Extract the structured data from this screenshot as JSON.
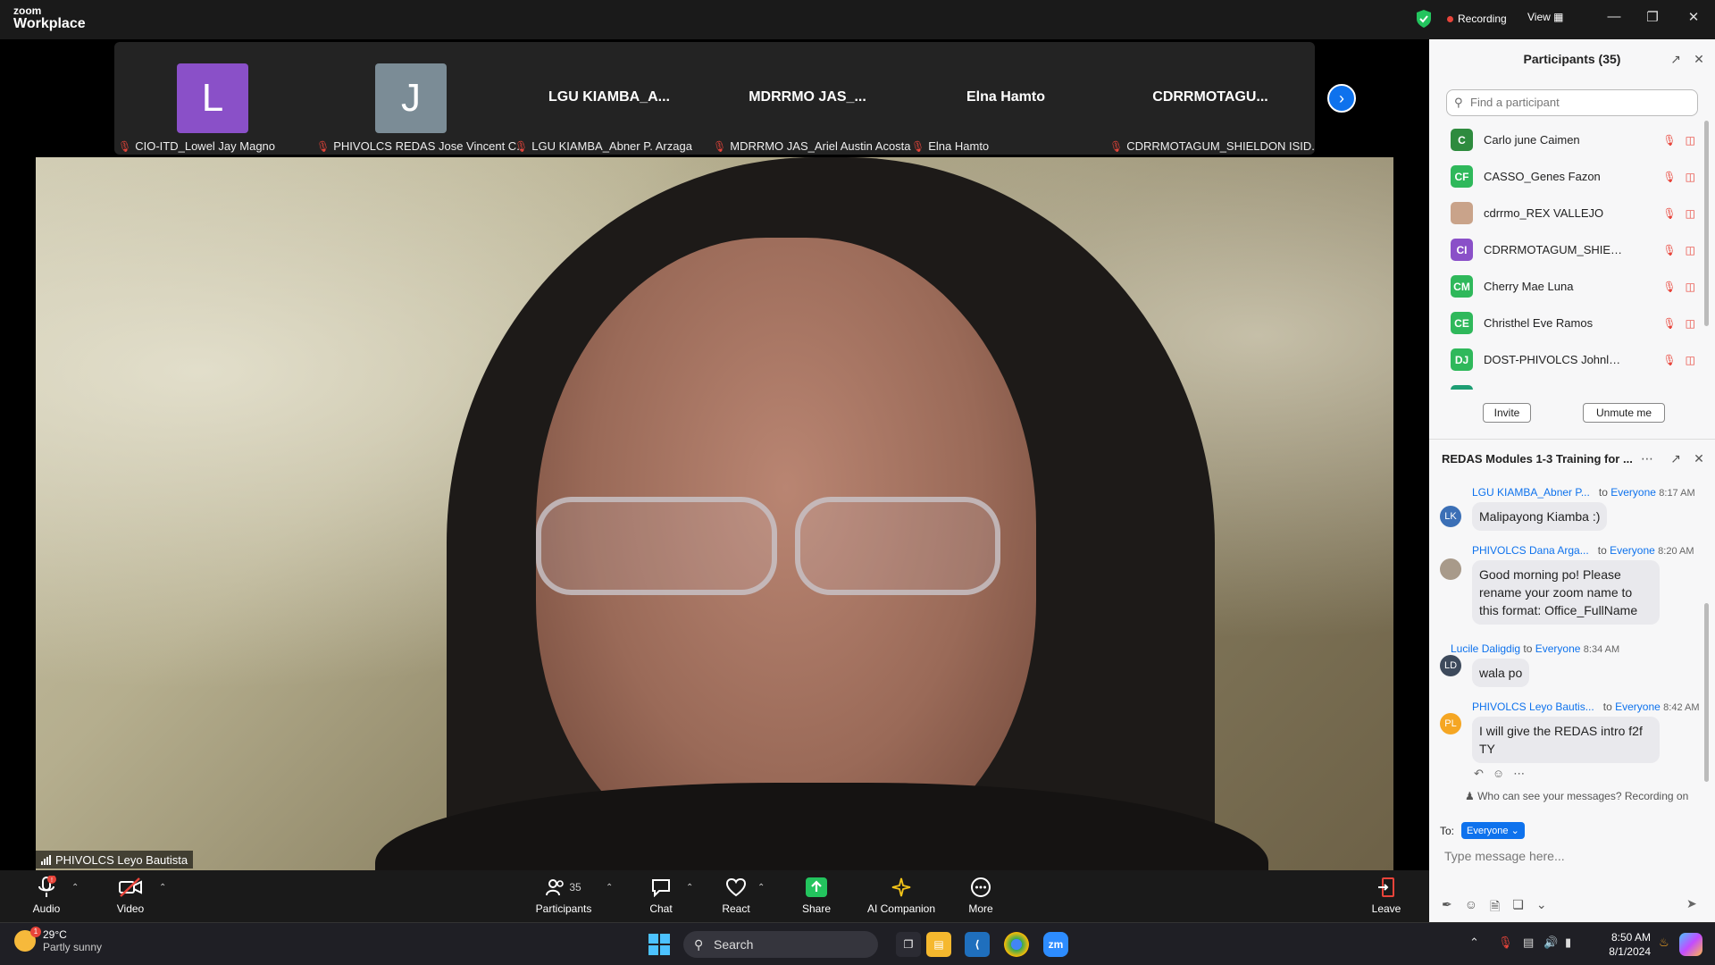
{
  "titlebar": {
    "brand_small": "zoom",
    "brand_large": "Workplace",
    "recording_label": "Recording",
    "view_label": "View"
  },
  "gallery": {
    "tiles": [
      {
        "initial": "L",
        "avatar_color": "#8a50c8",
        "name": "CIO-ITD_Lowel Jay Magno"
      },
      {
        "initial": "J",
        "avatar_color": "#7b8c96",
        "name": "PHIVOLCS REDAS Jose Vincent C..."
      },
      {
        "big_label": "LGU KIAMBA_A...",
        "name": "LGU KIAMBA_Abner P. Arzaga"
      },
      {
        "big_label": "MDRRMO  JAS_...",
        "name": "MDRRMO JAS_Ariel Austin Acosta"
      },
      {
        "big_label": "Elna Hamto",
        "name": "Elna Hamto"
      },
      {
        "big_label": "CDRRMOTAGU...",
        "name": "CDRRMOTAGUM_SHIELDON ISID..."
      }
    ]
  },
  "main_video": {
    "speaker_name": "PHIVOLCS Leyo Bautista"
  },
  "toolbar": {
    "audio_label": "Audio",
    "video_label": "Video",
    "participants_label": "Participants",
    "participants_count": "35",
    "chat_label": "Chat",
    "react_label": "React",
    "share_label": "Share",
    "ai_label": "AI Companion",
    "more_label": "More",
    "leave_label": "Leave"
  },
  "participants_panel": {
    "title": "Participants (35)",
    "search_placeholder": "Find a participant",
    "items": [
      {
        "initials": "C",
        "color": "#2e8b3e",
        "name": "Carlo june Caimen"
      },
      {
        "initials": "CF",
        "color": "#2fb85b",
        "name": "CASSO_Genes Fazon"
      },
      {
        "initials": "",
        "color": "#c9a38a",
        "name": "cdrrmo_REX VALLEJO"
      },
      {
        "initials": "CI",
        "color": "#8a50c8",
        "name": "CDRRMOTAGUM_SHIELDON ISI..."
      },
      {
        "initials": "CM",
        "color": "#2fb85b",
        "name": "Cherry Mae Luna"
      },
      {
        "initials": "CE",
        "color": "#2fb85b",
        "name": "Christhel Eve Ramos"
      },
      {
        "initials": "DJ",
        "color": "#2fb85b",
        "name": "DOST-PHIVOLCS Johnlery Dexi..."
      }
    ],
    "invite_label": "Invite",
    "unmute_label": "Unmute me"
  },
  "chat_panel": {
    "title": "REDAS Modules 1-3 Training for ...",
    "messages": [
      {
        "initials": "LK",
        "color": "#3b6fb6",
        "sender": "LGU KIAMBA_Abner P...",
        "to": "to",
        "audience": "Everyone",
        "time": "8:17 AM",
        "text": "Malipayong Kiamba :)"
      },
      {
        "initials": "",
        "color": "#a89a8a",
        "sender": "PHIVOLCS Dana Arga...",
        "to": "to",
        "audience": "Everyone",
        "time": "8:20 AM",
        "text": "Good morning po! Please rename your zoom name to this format: Office_FullName"
      },
      {
        "initials": "LD",
        "color": "#3d4a5c",
        "sender": "Lucile Daligdig",
        "to": "to",
        "audience": "Everyone",
        "time": "8:34 AM",
        "text": "wala po"
      },
      {
        "initials": "PL",
        "color": "#f5a623",
        "sender": "PHIVOLCS Leyo Bautis...",
        "to": "to",
        "audience": "Everyone",
        "time": "8:42 AM",
        "text": "I will give the REDAS intro f2f TY"
      }
    ],
    "notice": "Who can see your messages? Recording on",
    "to_label": "To:",
    "to_value": "Everyone",
    "input_placeholder": "Type message here..."
  },
  "taskbar": {
    "temperature": "29°C",
    "weather": "Partly sunny",
    "search_label": "Search",
    "time": "8:50 AM",
    "date": "8/1/2024",
    "zoom_app_label": "zm"
  }
}
